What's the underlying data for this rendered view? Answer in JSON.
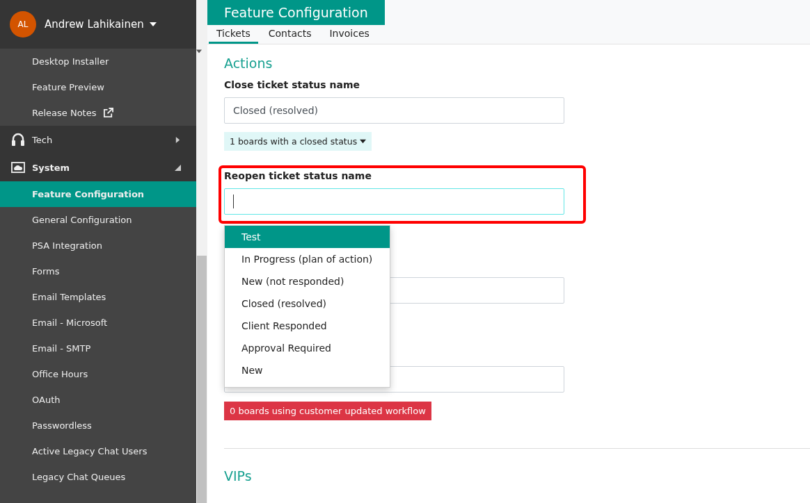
{
  "user": {
    "initials": "AL",
    "name": "Andrew Lahikainen"
  },
  "sidebar": {
    "items": [
      {
        "kind": "link",
        "label": "Desktop Installer",
        "selected": false,
        "external": false
      },
      {
        "kind": "link",
        "label": "Feature Preview",
        "selected": false,
        "external": false
      },
      {
        "kind": "link",
        "label": "Release Notes",
        "selected": false,
        "external": true
      },
      {
        "kind": "group",
        "label": "Tech",
        "expanded": false
      },
      {
        "kind": "group",
        "label": "System",
        "expanded": true
      },
      {
        "kind": "link",
        "label": "Feature Configuration",
        "selected": true,
        "external": false
      },
      {
        "kind": "link",
        "label": "General Configuration",
        "selected": false,
        "external": false
      },
      {
        "kind": "link",
        "label": "PSA Integration",
        "selected": false,
        "external": false
      },
      {
        "kind": "link",
        "label": "Forms",
        "selected": false,
        "external": false
      },
      {
        "kind": "link",
        "label": "Email Templates",
        "selected": false,
        "external": false
      },
      {
        "kind": "link",
        "label": "Email - Microsoft",
        "selected": false,
        "external": false
      },
      {
        "kind": "link",
        "label": "Email - SMTP",
        "selected": false,
        "external": false
      },
      {
        "kind": "link",
        "label": "Office Hours",
        "selected": false,
        "external": false
      },
      {
        "kind": "link",
        "label": "OAuth",
        "selected": false,
        "external": false
      },
      {
        "kind": "link",
        "label": "Passwordless",
        "selected": false,
        "external": false
      },
      {
        "kind": "link",
        "label": "Active Legacy Chat Users",
        "selected": false,
        "external": false
      },
      {
        "kind": "link",
        "label": "Legacy Chat Queues",
        "selected": false,
        "external": false
      }
    ]
  },
  "page": {
    "title": "Feature Configuration"
  },
  "tabs": [
    {
      "label": "Tickets",
      "selected": true
    },
    {
      "label": "Contacts",
      "selected": false
    },
    {
      "label": "Invoices",
      "selected": false
    }
  ],
  "actions": {
    "heading": "Actions",
    "close_label": "Close ticket status name",
    "close_value": "Closed (resolved)",
    "close_boards": "1 boards with a closed status",
    "reopen_label": "Reopen ticket status name",
    "reopen_options": [
      {
        "label": "Test",
        "selected": true
      },
      {
        "label": "In Progress (plan of action)",
        "selected": false
      },
      {
        "label": "New (not responded)",
        "selected": false
      },
      {
        "label": "Closed (resolved)",
        "selected": false
      },
      {
        "label": "Client Responded",
        "selected": false
      },
      {
        "label": "Approval Required",
        "selected": false
      },
      {
        "label": "New",
        "selected": false
      }
    ],
    "workflow_boards": "0 boards using customer updated workflow"
  },
  "vips": {
    "heading": "VIPs"
  }
}
